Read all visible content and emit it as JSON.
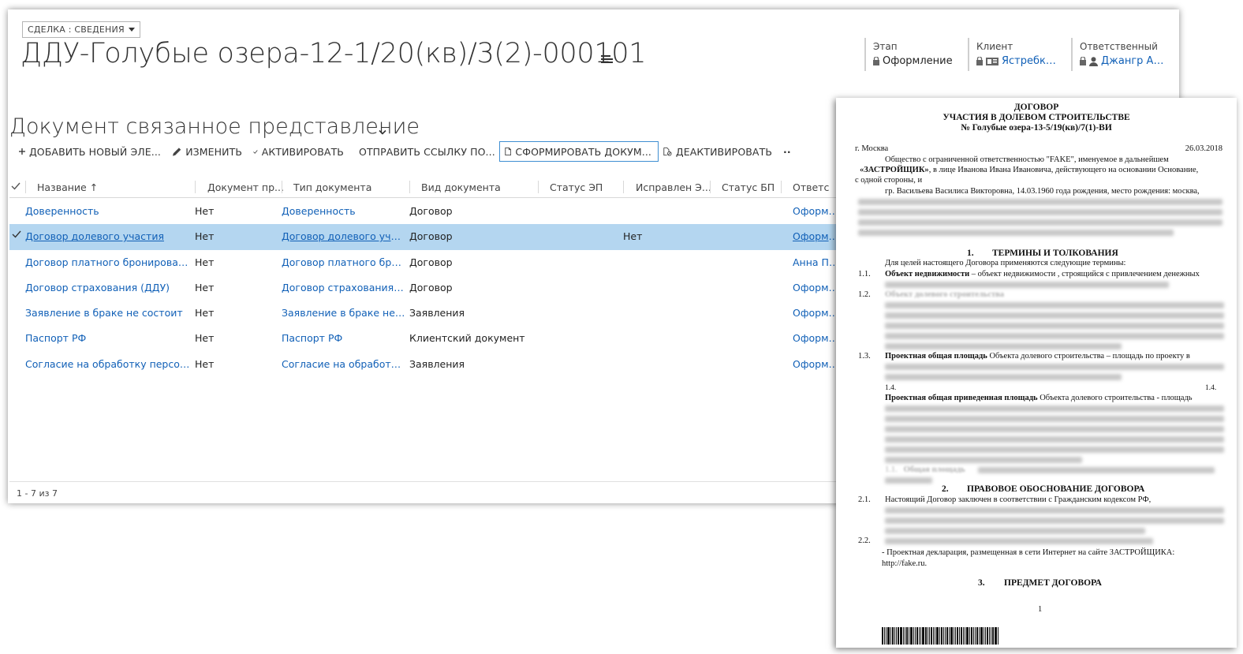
{
  "form_selector": {
    "label": "СДЕЛКА : СВЕДЕНИЯ"
  },
  "record": {
    "title": "ДДУ-Голубые озера-12-1/20(кв)/3(2)-000101"
  },
  "header_fields": [
    {
      "label": "Этап",
      "value": "Оформление",
      "is_link": false
    },
    {
      "label": "Клиент",
      "value": "Ястребк…",
      "is_link": true
    },
    {
      "label": "Ответственный",
      "value": "Джангр А…",
      "is_link": true
    }
  ],
  "section": {
    "title": "Документ связанное представление"
  },
  "toolbar": {
    "add_label": "ДОБАВИТЬ НОВЫЙ ЭЛЕ...",
    "edit_label": "ИЗМЕНИТЬ",
    "activate_label": "АКТИВИРОВАТЬ",
    "send_link_label": "ОТПРАВИТЬ ССЫЛКУ ПО...",
    "generate_label": "СФОРМИРОВАТЬ ДОКУМ...",
    "deactivate_label": "ДЕАКТИВИРОВАТЬ",
    "more_label": "··"
  },
  "grid": {
    "columns": [
      "Название ↑",
      "Документ пр...",
      "Тип документа",
      "Вид документа",
      "Статус ЭП",
      "Исправлен Э...",
      "Статус БП",
      "Ответс"
    ],
    "rows": [
      {
        "name": "Доверенность",
        "doc_pr": "Нет",
        "type": "Доверенность",
        "kind": "Договор",
        "ep_status": "",
        "fixed": "",
        "bp_status": "",
        "owner": "Оформит",
        "selected": false
      },
      {
        "name": "Договор долевого участия",
        "doc_pr": "Нет",
        "type": "Договор долевого участ...",
        "kind": "Договор",
        "ep_status": "",
        "fixed": "Нет",
        "bp_status": "",
        "owner": "Оформит",
        "selected": true
      },
      {
        "name": "Договор платного бронирования",
        "doc_pr": "Нет",
        "type": "Договор платного брон...",
        "kind": "Договор",
        "ep_status": "",
        "fixed": "",
        "bp_status": "",
        "owner": "Анна Пат",
        "selected": false
      },
      {
        "name": "Договор страхования (ДДУ)",
        "doc_pr": "Нет",
        "type": "Договор страхования (Д...",
        "kind": "Договор",
        "ep_status": "",
        "fixed": "",
        "bp_status": "",
        "owner": "Оформит",
        "selected": false
      },
      {
        "name": "Заявление в браке не состоит",
        "doc_pr": "Нет",
        "type": "Заявление в браке не с...",
        "kind": "Заявления",
        "ep_status": "",
        "fixed": "",
        "bp_status": "",
        "owner": "Оформит",
        "selected": false
      },
      {
        "name": "Паспорт РФ",
        "doc_pr": "Нет",
        "type": "Паспорт РФ",
        "kind": "Клиентский документ",
        "ep_status": "",
        "fixed": "",
        "bp_status": "",
        "owner": "Оформит",
        "selected": false
      },
      {
        "name": "Согласие на обработку персонал...",
        "doc_pr": "Нет",
        "type": "Согласие на обработку...",
        "kind": "Заявления",
        "ep_status": "",
        "fixed": "",
        "bp_status": "",
        "owner": "Оформит",
        "selected": false
      }
    ]
  },
  "status_bar": {
    "count_text": "1 - 7 из 7"
  },
  "doc": {
    "title1": "ДОГОВОР",
    "title2": "УЧАСТИЯ В ДОЛЕВОМ СТРОИТЕЛЬСТВЕ",
    "title3": "№ Голубые озера-13-5/19(кв)/7(1)-ВИ",
    "city": "г. Москва",
    "date": "26.03.2018",
    "p1a": "Общество с    ограниченной ответственностью \"FAKE\", именуемое в дальнейшем",
    "p1b_bold": "«ЗАСТРОЙЩИК»",
    "p1b_rest": ", в лице Иванова Ивана Ивановича, действующего на основании Основание,",
    "p1c": "с одной стороны, и",
    "p2": "гр. Васильева Василиса Викторовна, 14.03.1960 года рождения, место рождения: москва,",
    "s1_num": "1.",
    "s1_title": "ТЕРМИНЫ И ТОЛКОВАНИЯ",
    "s1_intro": "Для целей настоящего Договора применяются следующие термины:",
    "n11": "1.1.",
    "t11_bold": "Объект недвижимости",
    "t11_rest": " – объект недвижимости , строящийся с привлечением денежных",
    "n12": "1.2.",
    "t12_bold": "Объект долевого строительства",
    "n13": "1.3.",
    "t13_bold": "Проектная общая площадь",
    "t13_rest": " Объекта долевого строительства – площадь по проекту  в",
    "n14a": "1.4.",
    "n14b": "1.4.",
    "t14_bold": "Проектная общая приведенная площадь",
    "t14_rest": " Объекта долевого строительства - площадь",
    "n15": "1.1.",
    "t15_bold": "Общая площадь",
    "s2_num": "2.",
    "s2_title": "ПРАВОВОЕ ОБОСНОВАНИЕ ДОГОВОРА",
    "n21": "2.1.",
    "t21": "Настоящий  Договор  заключен  в  соответствии  с  Гражданским  кодексом  РФ,",
    "n22": "2.2.",
    "t22a": "- Проектная  декларация,  размещенная  в  сети  Интернет  на  сайте  ЗАСТРОЙЩИКА:",
    "t22b": "http://fake.ru.",
    "s3_num": "3.",
    "s3_title": "ПРЕДМЕТ ДОГОВОРА",
    "page_num": "1"
  }
}
